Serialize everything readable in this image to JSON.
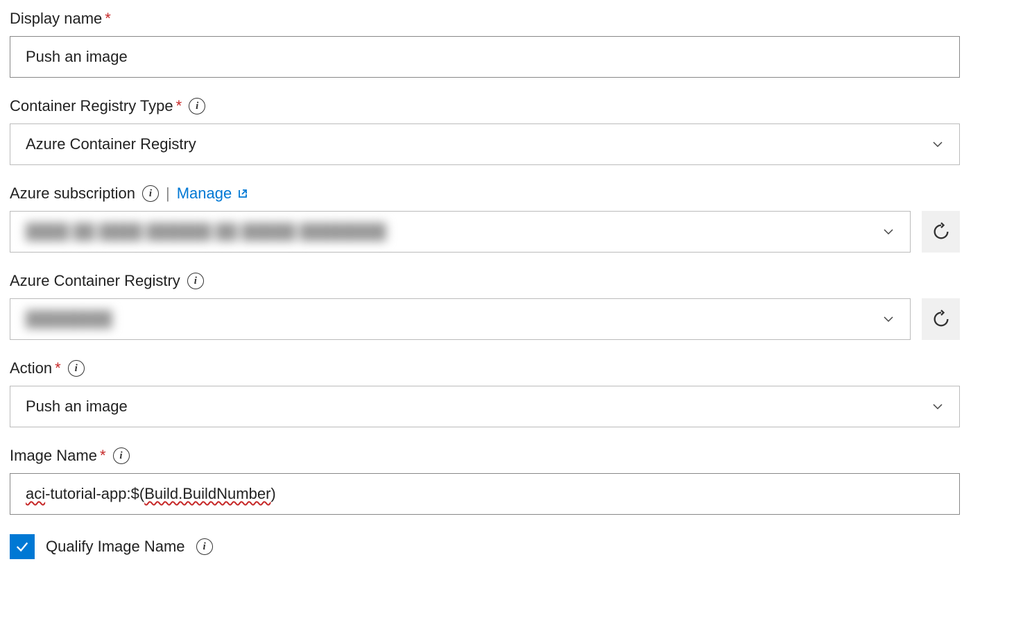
{
  "fields": {
    "displayName": {
      "label": "Display name",
      "required": true,
      "value": "Push an image"
    },
    "containerRegistryType": {
      "label": "Container Registry Type",
      "required": true,
      "value": "Azure Container Registry"
    },
    "azureSubscription": {
      "label": "Azure subscription",
      "manageLink": "Manage",
      "value": ""
    },
    "azureContainerRegistry": {
      "label": "Azure Container Registry",
      "value": ""
    },
    "action": {
      "label": "Action",
      "required": true,
      "value": "Push an image"
    },
    "imageName": {
      "label": "Image Name",
      "required": true,
      "prefix": "aci",
      "middle": "-tutorial-app:$(",
      "spelled": "Build.BuildNumber",
      "suffix": ")"
    },
    "qualifyImageName": {
      "label": "Qualify Image Name",
      "checked": true
    }
  }
}
